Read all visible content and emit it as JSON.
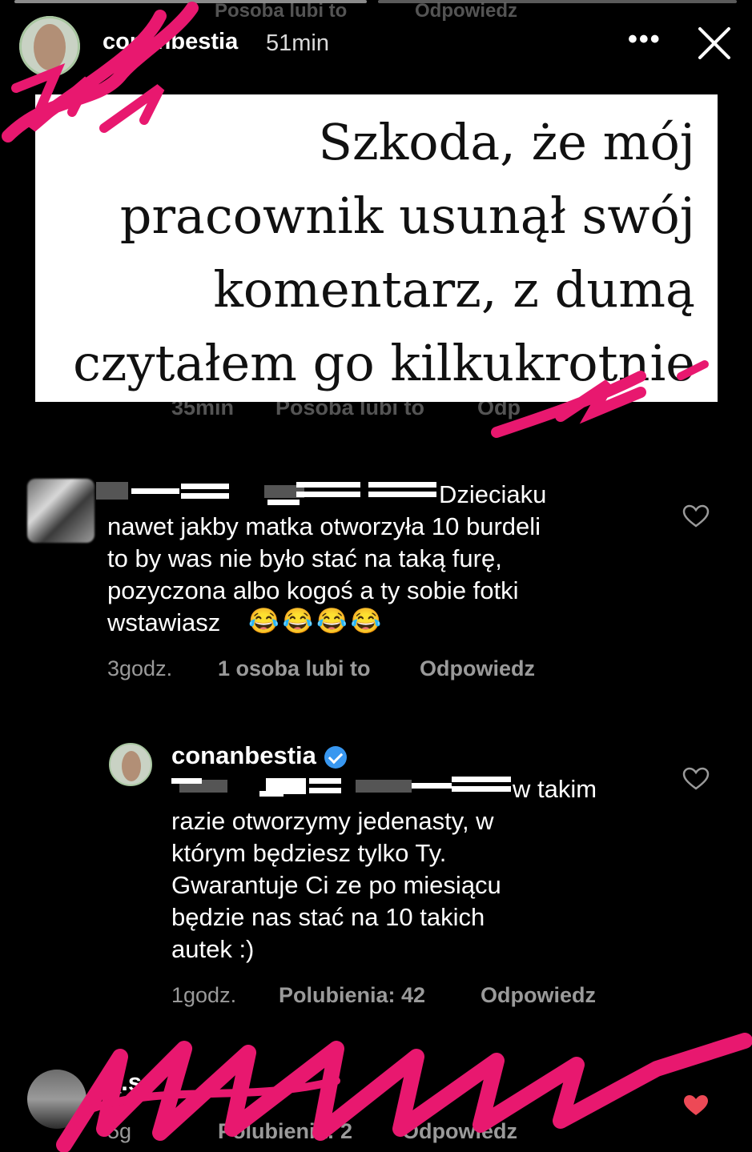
{
  "story_header": {
    "username": "conanbestia",
    "time_ago": "51min",
    "more_icon": "more-horizontal-icon",
    "close_icon": "close-icon"
  },
  "background_ghost": {
    "top_meta": "Posoba lubi to",
    "top_reply": "Odpowiedz",
    "mid_time": "35min",
    "mid_likes": "Posoba lubi to",
    "mid_reply": "Odp"
  },
  "sticker": {
    "text": "Szkoda, że mój pracownik usunął swój komentarz, z dumą czytałem go kilkukrotnie"
  },
  "comments": [
    {
      "text_visible": "Dzieciaku nawet jakby matka otworzyła 10 burdeli to by was nie było stać na taką furę, pozyczona albo kogoś a ty sobie fotki wstawiasz",
      "line1": "Dzieciaku",
      "line2": "nawet jakby matka otworzyła 10 burdeli",
      "line3": "to by was nie było stać na taką furę,",
      "line4": "pozyczona albo kogoś a ty sobie fotki",
      "line5": "wstawiasz",
      "emojis": "😂😂😂😂",
      "time": "3godz.",
      "likes": "1 osoba lubi to",
      "reply": "Odpowiedz"
    },
    {
      "username": "conanbestia",
      "line1": "w takim",
      "line2": "razie otworzymy jedenasty, w",
      "line3": "którym będziesz tylko Ty.",
      "line4": "Gwarantuje Ci ze po miesiącu",
      "line5": "będzie nas stać na 10 takich",
      "line6": "autek :)",
      "time": "1godz.",
      "likes": "Polubienia: 42",
      "reply": "Odpowiedz"
    },
    {
      "username_partial": "_.so",
      "time": "5g",
      "likes": "Polubienia: 2",
      "reply": "Odpowiedz"
    }
  ],
  "colors": {
    "background": "#000000",
    "scribble": "#e8186f",
    "verified": "#3897f0",
    "heart_liked": "#ed4956",
    "meta_text": "#9a9a9a"
  }
}
